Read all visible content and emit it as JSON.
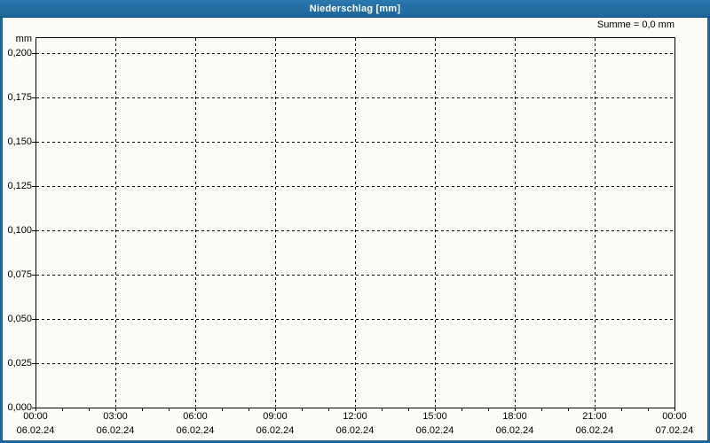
{
  "header": {
    "title": "Niederschlag [mm]"
  },
  "summary": {
    "text": "Summe = 0,0 mm"
  },
  "chart_data": {
    "type": "bar",
    "title": "Niederschlag [mm]",
    "ylabel": "mm",
    "unit_label": "mm",
    "ylim": [
      0,
      0.2
    ],
    "y_tick_labels": [
      "0,000",
      "0,025",
      "0,050",
      "0,075",
      "0,100",
      "0,125",
      "0,150",
      "0,175",
      "0,200"
    ],
    "y_tick_values": [
      0,
      0.025,
      0.05,
      0.075,
      0.1,
      0.125,
      0.15,
      0.175,
      0.2
    ],
    "x_ticks": [
      {
        "time": "00:00",
        "date": "06.02.24"
      },
      {
        "time": "03:00",
        "date": "06.02.24"
      },
      {
        "time": "06:00",
        "date": "06.02.24"
      },
      {
        "time": "09:00",
        "date": "06.02.24"
      },
      {
        "time": "12:00",
        "date": "06.02.24"
      },
      {
        "time": "15:00",
        "date": "06.02.24"
      },
      {
        "time": "18:00",
        "date": "06.02.24"
      },
      {
        "time": "21:00",
        "date": "06.02.24"
      },
      {
        "time": "00:00",
        "date": "07.02.24"
      }
    ],
    "minor_x_ticks_per_major": 3,
    "grid": "dashed",
    "legend": "none",
    "series": [
      {
        "name": "Niederschlag",
        "values": []
      }
    ],
    "sum_label": "Summe = 0,0 mm"
  },
  "colors": {
    "frame_blue": "#1e6699",
    "titlebar_blue": "#2273a8",
    "background": "#fcfcf6",
    "grid_line": "#000000",
    "axis_line": "#000000",
    "title_text": "#ffffff",
    "label_text": "#000000"
  }
}
